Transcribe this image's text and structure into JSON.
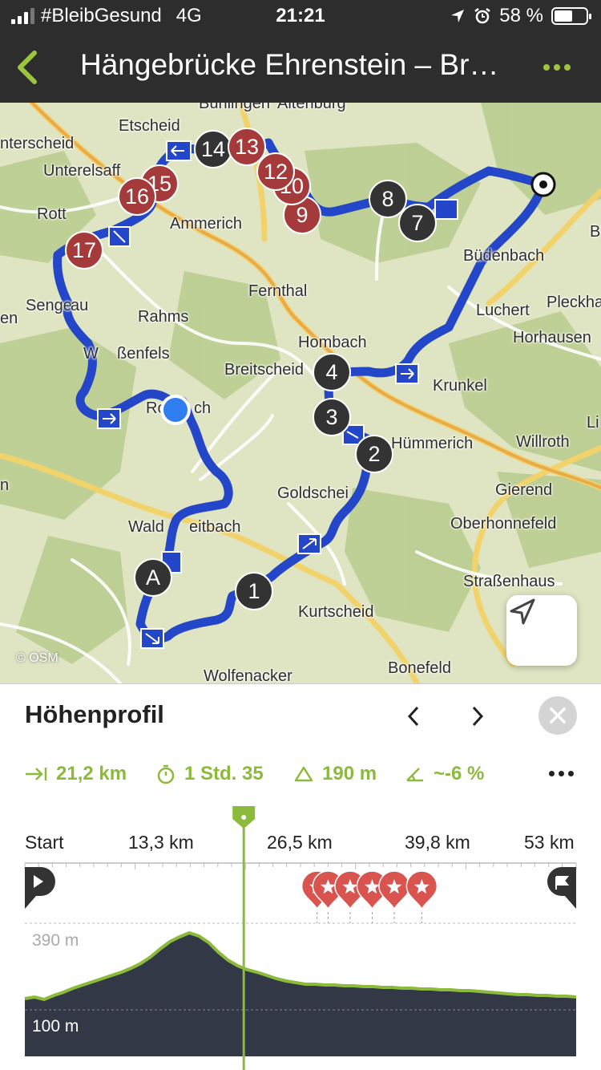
{
  "status": {
    "carrier": "#BleibGesund",
    "network": "4G",
    "time": "21:21",
    "battery": "58 %",
    "battery_level": 0.58
  },
  "header": {
    "title": "Hängebrücke Ehrenstein – Br…",
    "back_icon": "chevron-left-icon",
    "menu_icon": "more-dots-icon",
    "accent": "#9bc63b"
  },
  "map": {
    "attribution": "© OSM",
    "places": [
      "Bühlingen",
      "Altenburg",
      "Etscheid",
      "nterscheid",
      "Unterelsaff",
      "Rott",
      "Ammerich",
      "Büdenbach",
      "B",
      "Fernthal",
      "Luchert",
      "Pleckha",
      "Senge",
      "au",
      "en",
      "Rahms",
      "Horhausen",
      "Hombach",
      "W",
      "ßenfels",
      "Breitscheid",
      "Krunkel",
      "Ro",
      "ch",
      "Li",
      "Hümmerich",
      "Willroth",
      "n",
      "Gierend",
      "Goldschei",
      "Oberhonnefeld",
      "Wald",
      "eitbach",
      "Straßenhaus",
      "Kurtscheid",
      "Bonefeld",
      "Wolfenacker"
    ],
    "waypoints_dark": [
      "1",
      "2",
      "3",
      "4",
      "7",
      "8",
      "14"
    ],
    "waypoints_red": [
      "9",
      "10",
      "12",
      "13",
      "15",
      "16",
      "17"
    ],
    "start_marker": "A",
    "locate_icon": "navigation-arrow-icon"
  },
  "profile": {
    "title": "Höhenprofil",
    "stats": {
      "distance": "21,2 km",
      "duration": "1 Std. 35",
      "ascent": "190 m",
      "gradient": "~-6 %"
    },
    "axis": [
      "Start",
      "13,3 km",
      "26,5 km",
      "39,8 km",
      "53 km"
    ],
    "elev_top": "390 m",
    "elev_bottom": "100 m",
    "elevation_series": [
      22,
      24,
      21,
      26,
      30,
      35,
      39,
      43,
      47,
      51,
      55,
      60,
      66,
      74,
      84,
      93,
      99,
      104,
      100,
      92,
      80,
      70,
      63,
      58,
      55,
      51,
      47,
      44,
      42,
      40,
      40,
      39,
      39,
      38,
      38,
      37,
      37,
      36,
      36,
      35,
      35,
      34,
      34,
      33,
      33,
      32,
      32,
      31,
      30,
      29,
      28,
      27,
      27,
      26,
      26,
      25,
      25,
      24
    ],
    "cursor_position": 0.4,
    "poi_positions": [
      0.53,
      0.55,
      0.59,
      0.63,
      0.67,
      0.72
    ]
  }
}
